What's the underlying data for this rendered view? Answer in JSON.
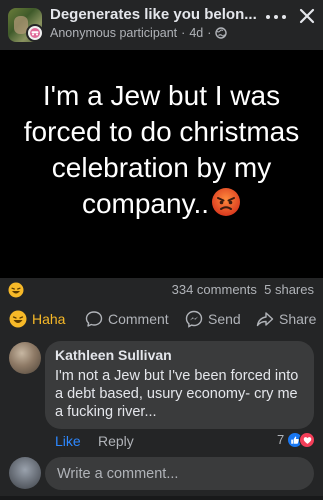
{
  "header": {
    "group_name": "Degenerates like you belon...",
    "author": "Anonymous participant",
    "time": "4d",
    "icons": [
      "anonymous-icon",
      "globe-icon",
      "more-icon",
      "close-icon"
    ]
  },
  "post": {
    "text": "I'm  a Jew but I was forced to do christmas celebration by my company..",
    "emoji": "angry-emoji"
  },
  "stats": {
    "reaction": "haha-icon",
    "comments": "334 comments",
    "shares": "5 shares"
  },
  "actions": {
    "haha": "Haha",
    "comment": "Comment",
    "send": "Send",
    "share": "Share"
  },
  "comment": {
    "author": "Kathleen Sullivan",
    "text": "I'm not a Jew but I've been forced into a debt based, usury economy- cry me a fucking river...",
    "like": "Like",
    "reply": "Reply",
    "reaction_count": "7",
    "reactions": [
      "like-icon",
      "love-icon"
    ]
  },
  "composer": {
    "placeholder": "Write a comment..."
  },
  "colors": {
    "accent_blue": "#2d88ff",
    "haha_yellow": "#f7b928",
    "love_red": "#f33e58",
    "angry_orange": "#e8552a"
  }
}
